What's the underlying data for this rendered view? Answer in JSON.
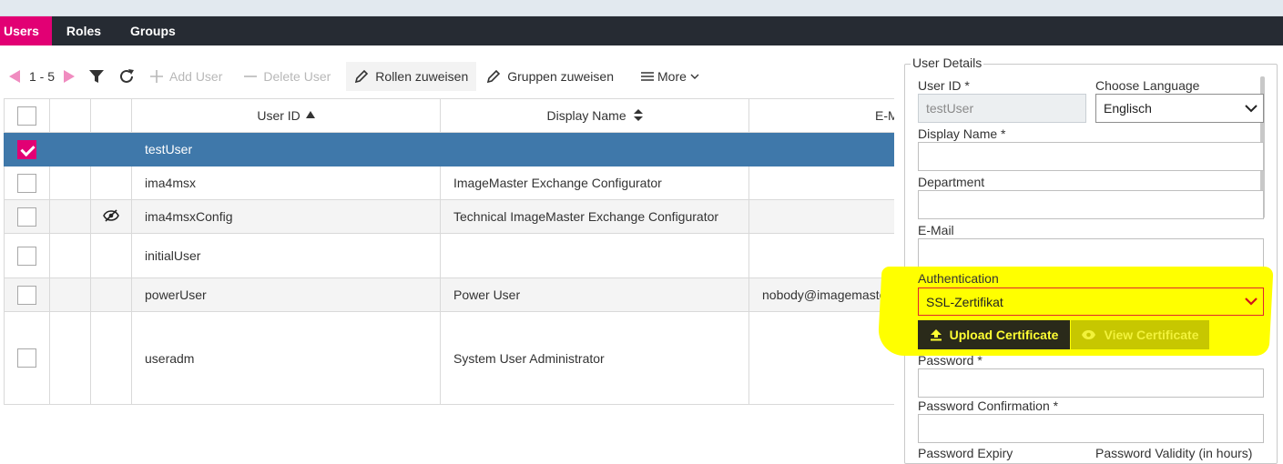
{
  "tabs": [
    {
      "label": "Users",
      "active": true
    },
    {
      "label": "Roles",
      "active": false
    },
    {
      "label": "Groups",
      "active": false
    }
  ],
  "toolbar": {
    "range": "1 - 5",
    "add_user": "Add User",
    "delete_user": "Delete User",
    "assign_roles": "Rollen zuweisen",
    "assign_groups": "Gruppen zuweisen",
    "more": "More"
  },
  "grid": {
    "columns": [
      "User ID",
      "Display Name",
      "E-M"
    ],
    "rows": [
      {
        "user_id": "testUser",
        "display_name": "",
        "email": ""
      },
      {
        "user_id": "ima4msx",
        "display_name": "ImageMaster Exchange Configurator",
        "email": ""
      },
      {
        "user_id": "ima4msxConfig",
        "display_name": "Technical ImageMaster Exchange Configurator",
        "email": ""
      },
      {
        "user_id": "initialUser",
        "display_name": "",
        "email": ""
      },
      {
        "user_id": "powerUser",
        "display_name": "Power User",
        "email": "nobody@imagemaster"
      },
      {
        "user_id": "useradm",
        "display_name": "System User Administrator",
        "email": ""
      }
    ]
  },
  "details": {
    "legend": "User Details",
    "user_id_label": "User ID  *",
    "user_id_value": "testUser",
    "language_label": "Choose Language",
    "language_value": "Englisch",
    "display_name_label": "Display Name  *",
    "department_label": "Department",
    "email_label": "E-Mail",
    "auth_label": "Authentication",
    "auth_value": "SSL-Zertifikat",
    "upload_cert": "Upload Certificate",
    "view_cert": "View Certificate",
    "password_label": "Password  *",
    "password_confirm_label": "Password Confirmation  *",
    "password_expiry_label": "Password Expiry",
    "password_validity_label": "Password Validity (in hours)"
  },
  "colors": {
    "accent": "#e20074",
    "tabbar": "#262b33",
    "selected_row": "#3f78aa",
    "highlight": "#ffff00"
  }
}
